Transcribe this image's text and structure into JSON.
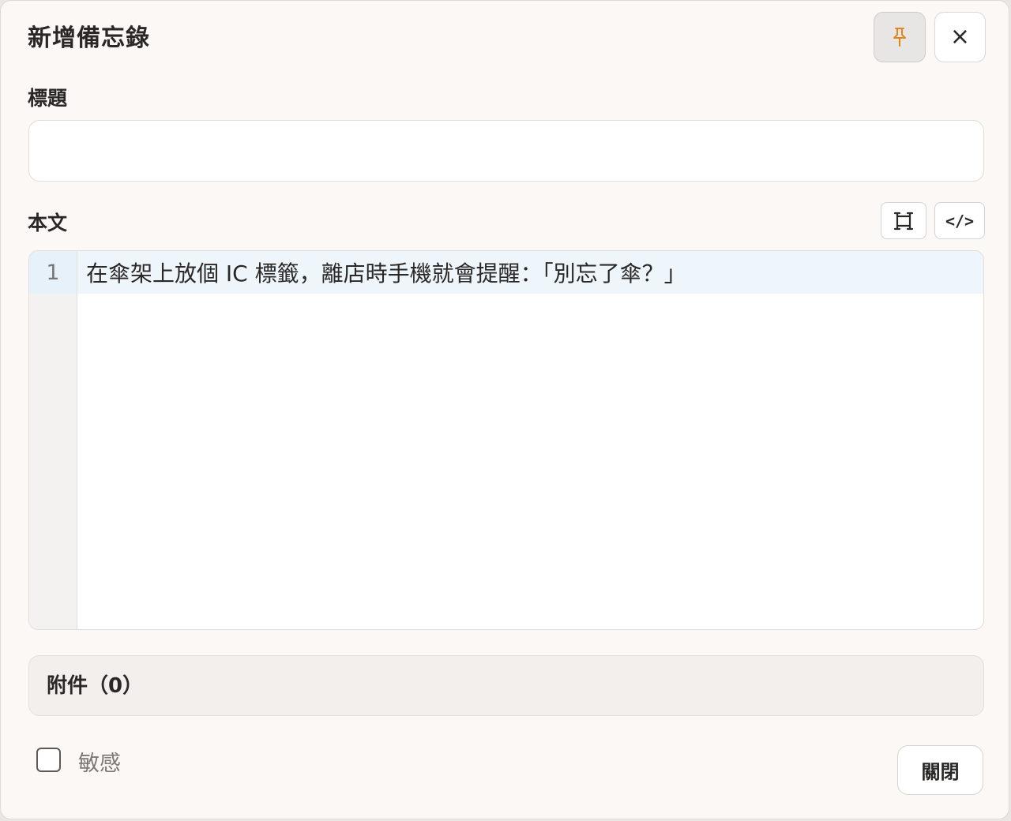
{
  "dialog": {
    "title": "新增備忘錄"
  },
  "header": {
    "pin_icon": "pin-icon",
    "close_icon": "close-icon",
    "close_glyph": "×",
    "accent_color": "#e0861c"
  },
  "form": {
    "title_label": "標題",
    "title_value": "",
    "body_label": "本文",
    "expand_icon": "expand-icon",
    "code_label": "</>"
  },
  "editor": {
    "lines": [
      {
        "number": "1",
        "text": "在傘架上放個 IC 標籤，離店時手機就會提醒：「別忘了傘？」"
      }
    ]
  },
  "attachments": {
    "label": "附件（0）"
  },
  "footer": {
    "sensitive_label": "敏感",
    "sensitive_checked": false,
    "close_label": "關閉"
  }
}
